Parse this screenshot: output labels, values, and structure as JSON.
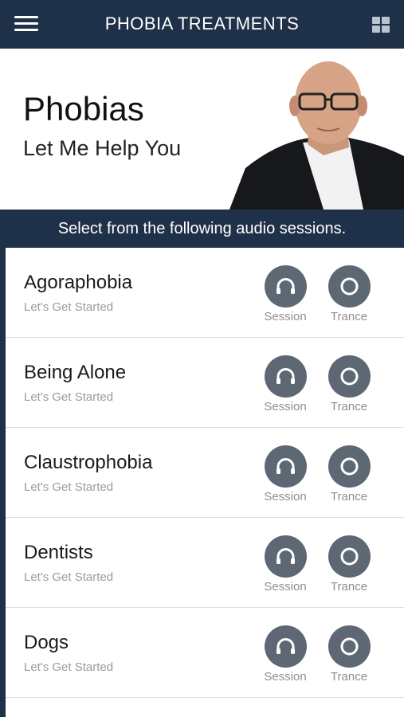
{
  "header": {
    "title": "PHOBIA TREATMENTS",
    "menu_icon": "hamburger-icon",
    "grid_icon": "grid-icon"
  },
  "hero": {
    "title": "Phobias",
    "subtitle": "Let Me Help You"
  },
  "banner": {
    "text": "Select from the following audio sessions."
  },
  "sessions": [
    {
      "name": "Agoraphobia",
      "subtitle": "Let's Get Started",
      "session_label": "Session",
      "trance_label": "Trance"
    },
    {
      "name": "Being Alone",
      "subtitle": "Let's Get Started",
      "session_label": "Session",
      "trance_label": "Trance"
    },
    {
      "name": "Claustrophobia",
      "subtitle": "Let's Get Started",
      "session_label": "Session",
      "trance_label": "Trance"
    },
    {
      "name": "Dentists",
      "subtitle": "Let's Get Started",
      "session_label": "Session",
      "trance_label": "Trance"
    },
    {
      "name": "Dogs",
      "subtitle": "Let's Get Started",
      "session_label": "Session",
      "trance_label": "Trance"
    }
  ],
  "colors": {
    "header_bg": "#1f3149",
    "button_bg": "#5d6874",
    "label_gray": "#8e8e8e"
  }
}
